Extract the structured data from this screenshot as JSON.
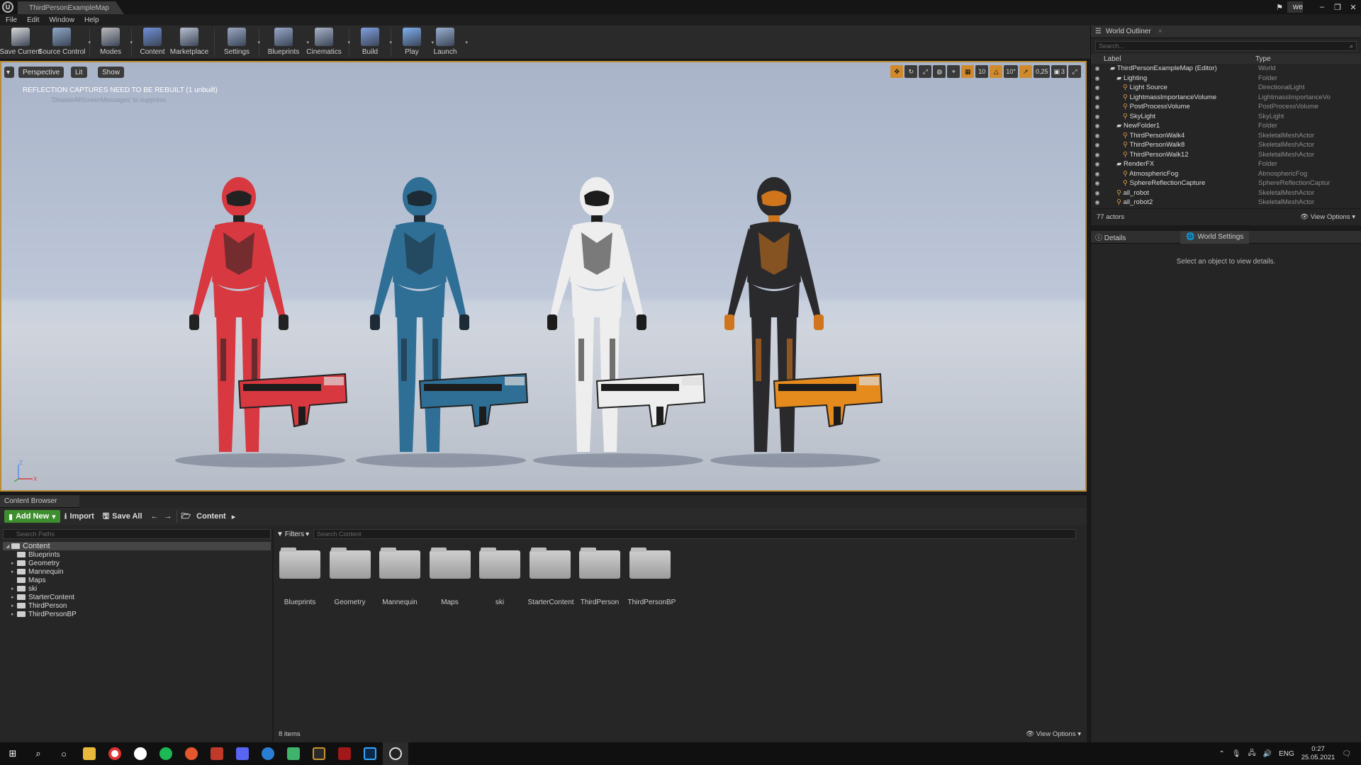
{
  "title_tab": "ThirdPersonExampleMap",
  "user": "we",
  "menu": [
    "File",
    "Edit",
    "Window",
    "Help"
  ],
  "toolbar": [
    {
      "label": "Save Current",
      "color": "#d8d8d8",
      "drop": false
    },
    {
      "label": "Source Control",
      "color": "#8fa8c8",
      "drop": true
    },
    {
      "label": "Modes",
      "color": "#bbbbbb",
      "drop": true
    },
    {
      "label": "Content",
      "color": "#6f8fd8",
      "drop": false
    },
    {
      "label": "Marketplace",
      "color": "#b8c0d0",
      "drop": false
    },
    {
      "label": "Settings",
      "color": "#9aa8c0",
      "drop": true
    },
    {
      "label": "Blueprints",
      "color": "#9aa8c8",
      "drop": true
    },
    {
      "label": "Cinematics",
      "color": "#aab4c8",
      "drop": true
    },
    {
      "label": "Build",
      "color": "#7fa0e0",
      "drop": true
    },
    {
      "label": "Play",
      "color": "#7fb0f0",
      "drop": true
    },
    {
      "label": "Launch",
      "color": "#9ab0d0",
      "drop": true
    }
  ],
  "viewport": {
    "perspective": "Perspective",
    "lit": "Lit",
    "show": "Show",
    "message": "REFLECTION CAPTURES NEED TO BE REBUILT (1 unbuilt)",
    "message_hint": "'DisableAllScreenMessages' to suppress",
    "grid": "10",
    "angle": "10°",
    "scale": "0,25",
    "camera_speed": "3"
  },
  "outliner": {
    "tab": "World Outliner",
    "search_placeholder": "Search...",
    "col_label": "Label",
    "col_type": "Type",
    "rows": [
      {
        "indent": 1,
        "label": "ThirdPersonExampleMap (Editor)",
        "type": "World"
      },
      {
        "indent": 2,
        "label": "Lighting",
        "type": "Folder"
      },
      {
        "indent": 3,
        "label": "Light Source",
        "type": "DirectionalLight"
      },
      {
        "indent": 3,
        "label": "LightmassImportanceVolume",
        "type": "LightmassImportanceVo"
      },
      {
        "indent": 3,
        "label": "PostProcessVolume",
        "type": "PostProcessVolume"
      },
      {
        "indent": 3,
        "label": "SkyLight",
        "type": "SkyLight"
      },
      {
        "indent": 2,
        "label": "NewFolder1",
        "type": "Folder"
      },
      {
        "indent": 3,
        "label": "ThirdPersonWalk4",
        "type": "SkeletalMeshActor"
      },
      {
        "indent": 3,
        "label": "ThirdPersonWalk8",
        "type": "SkeletalMeshActor"
      },
      {
        "indent": 3,
        "label": "ThirdPersonWalk12",
        "type": "SkeletalMeshActor"
      },
      {
        "indent": 2,
        "label": "RenderFX",
        "type": "Folder"
      },
      {
        "indent": 3,
        "label": "AtmosphericFog",
        "type": "AtmosphericFog"
      },
      {
        "indent": 3,
        "label": "SphereReflectionCapture",
        "type": "SphereReflectionCaptur"
      },
      {
        "indent": 2,
        "label": "all_robot",
        "type": "SkeletalMeshActor"
      },
      {
        "indent": 2,
        "label": "all_robot2",
        "type": "SkeletalMeshActor"
      }
    ],
    "actors": "77 actors",
    "view_options": "View Options"
  },
  "details": {
    "tab_details": "Details",
    "tab_world": "World Settings",
    "empty": "Select an object to view details."
  },
  "content_browser": {
    "tab": "Content Browser",
    "add_new": "Add New",
    "import": "Import",
    "save_all": "Save All",
    "path": "Content",
    "search_paths": "Search Paths",
    "filters": "Filters",
    "search_content": "Search Content",
    "tree": [
      "Content",
      "Blueprints",
      "Geometry",
      "Mannequin",
      "Maps",
      "ski",
      "StarterContent",
      "ThirdPerson",
      "ThirdPersonBP"
    ],
    "folders": [
      "Blueprints",
      "Geometry",
      "Mannequin",
      "Maps",
      "ski",
      "StarterContent",
      "ThirdPerson",
      "ThirdPersonBP"
    ],
    "items": "8 items",
    "view_options": "View Options"
  },
  "characters": [
    {
      "body": "#d8383f",
      "dark": "#222222"
    },
    {
      "body": "#2f6f96",
      "dark": "#1c2b36"
    },
    {
      "body": "#eeeeee",
      "dark": "#1c1c1c"
    },
    {
      "body": "#2a2a2c",
      "dark": "#d0751c"
    }
  ],
  "taskbar": {
    "lang": "ENG",
    "time": "0:27",
    "date": "25.05.2021"
  }
}
